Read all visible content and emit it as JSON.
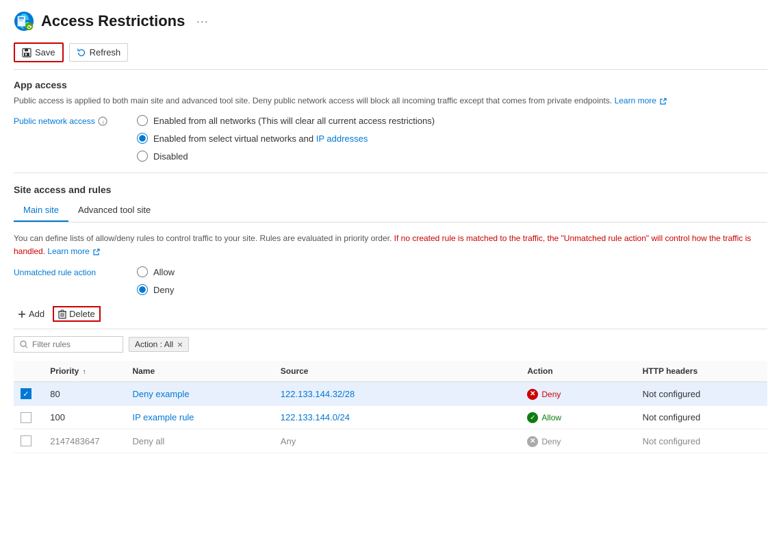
{
  "header": {
    "title": "Access Restrictions",
    "dots_label": "···"
  },
  "toolbar": {
    "save_label": "Save",
    "refresh_label": "Refresh"
  },
  "app_access": {
    "section_title": "App access",
    "info_text": "Public access is applied to both main site and advanced tool site. Deny public network access will block all incoming traffic except that comes from private endpoints.",
    "learn_more": "Learn more",
    "public_network_access_label": "Public network access",
    "radio_options": [
      {
        "id": "opt1",
        "label": "Enabled from all networks (This will clear all current access restrictions)",
        "checked": false
      },
      {
        "id": "opt2",
        "label": "Enabled from select virtual networks and IP addresses",
        "checked": true,
        "link_text": "IP addresses",
        "label_before": "Enabled from select virtual networks and ",
        "label_after": ""
      },
      {
        "id": "opt3",
        "label": "Disabled",
        "checked": false
      }
    ]
  },
  "site_access": {
    "section_title": "Site access and rules",
    "tabs": [
      {
        "id": "main",
        "label": "Main site",
        "active": true
      },
      {
        "id": "advanced",
        "label": "Advanced tool site",
        "active": false
      }
    ],
    "rules_info_part1": "You can define lists of allow/deny rules to control traffic to your site. Rules are evaluated in priority order.",
    "rules_info_red": " If no created rule is matched to the traffic, the \"Unmatched rule action\" will control how the traffic is handled.",
    "rules_info_learn": "Learn more",
    "unmatched_rule_action_label": "Unmatched rule action",
    "unmatched_options": [
      {
        "id": "ua1",
        "label": "Allow",
        "checked": false
      },
      {
        "id": "ua2",
        "label": "Deny",
        "checked": true
      }
    ]
  },
  "actions_row": {
    "add_label": "Add",
    "delete_label": "Delete"
  },
  "filter": {
    "placeholder": "Filter rules",
    "tag_label": "Action : All",
    "tag_close": "×"
  },
  "table": {
    "columns": [
      {
        "id": "check",
        "label": ""
      },
      {
        "id": "priority",
        "label": "Priority",
        "sort": "↑"
      },
      {
        "id": "name",
        "label": "Name"
      },
      {
        "id": "source",
        "label": "Source"
      },
      {
        "id": "action",
        "label": "Action"
      },
      {
        "id": "http",
        "label": "HTTP headers"
      }
    ],
    "rows": [
      {
        "selected": true,
        "priority": "80",
        "name": "Deny example",
        "source": "122.133.144.32/28",
        "action": "Deny",
        "action_type": "deny",
        "http": "Not configured"
      },
      {
        "selected": false,
        "priority": "100",
        "name": "IP example rule",
        "source": "122.133.144.0/24",
        "action": "Allow",
        "action_type": "allow",
        "http": "Not configured"
      },
      {
        "selected": false,
        "priority": "2147483647",
        "name": "Deny all",
        "source": "Any",
        "action": "Deny",
        "action_type": "deny-dim",
        "http": "Not configured"
      }
    ]
  }
}
